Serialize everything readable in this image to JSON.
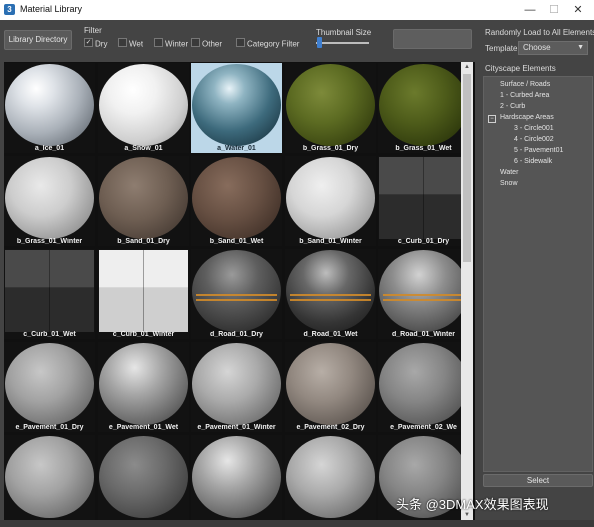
{
  "window": {
    "title": "Material Library",
    "minimize": "—",
    "maximize": "☐",
    "close": "✕"
  },
  "toolbar": {
    "library_directory": "Library Directory",
    "filter_label": "Filter",
    "filters": [
      {
        "label": "Dry",
        "checked": true
      },
      {
        "label": "Wet",
        "checked": false
      },
      {
        "label": "Winter",
        "checked": false
      },
      {
        "label": "Other",
        "checked": false
      }
    ],
    "category_filter": {
      "label": "Category Filter",
      "checked": false
    },
    "thumbnail_size_label": "Thumbnail Size",
    "thumbnail_size_value": 0.02,
    "search_value": ""
  },
  "materials": [
    {
      "label": "a_Ice_01",
      "style": "ice"
    },
    {
      "label": "a_Snow_01",
      "style": "snow"
    },
    {
      "label": "a_Water_01",
      "style": "water",
      "selected": true
    },
    {
      "label": "b_Grass_01_Dry",
      "style": "grass"
    },
    {
      "label": "b_Grass_01_Wet",
      "style": "grasswet"
    },
    {
      "label": "b_Grass_01_Winter",
      "style": "grasswinter"
    },
    {
      "label": "b_Sand_01_Dry",
      "style": "sand"
    },
    {
      "label": "b_Sand_01_Wet",
      "style": "sandwet"
    },
    {
      "label": "b_Sand_01_Winter",
      "style": "sandwinter"
    },
    {
      "label": "c_Curb_01_Dry",
      "style": "curbdry"
    },
    {
      "label": "c_Curb_01_Wet",
      "style": "curbwet"
    },
    {
      "label": "c_Curb_01_Winter",
      "style": "curbwinter"
    },
    {
      "label": "d_Road_01_Dry",
      "style": "road"
    },
    {
      "label": "d_Road_01_Wet",
      "style": "roadwet"
    },
    {
      "label": "d_Road_01_Winter",
      "style": "roadwinter"
    },
    {
      "label": "e_Pavement_01_Dry",
      "style": "pavement"
    },
    {
      "label": "e_Pavement_01_Wet",
      "style": "pavementwet"
    },
    {
      "label": "e_Pavement_01_Winter",
      "style": "pavementwinter"
    },
    {
      "label": "e_Pavement_02_Dry",
      "style": "brick"
    },
    {
      "label": "e_Pavement_02_We",
      "style": "brickwet"
    },
    {
      "label": "",
      "style": "pavement"
    },
    {
      "label": "",
      "style": "cobble"
    },
    {
      "label": "",
      "style": "pavementwet"
    },
    {
      "label": "",
      "style": "pavementwinter"
    },
    {
      "label": "",
      "style": "brickwet"
    }
  ],
  "side": {
    "title": "Randomly Load to All Elements",
    "template_label": "Template",
    "template_value": "Choose",
    "template_arrow": "▼",
    "cityscape_label": "Cityscape Elements",
    "tree": [
      {
        "label": "Surface / Roads",
        "level": 0
      },
      {
        "label": "1 - Curbed Area",
        "level": 1
      },
      {
        "label": "2 - Curb",
        "level": 1
      },
      {
        "label": "Hardscape Areas",
        "level": 0,
        "expanded": true,
        "toggle": "−"
      },
      {
        "label": "3 - Circle001",
        "level": 2
      },
      {
        "label": "4 - Circle002",
        "level": 2
      },
      {
        "label": "5 - Pavement01",
        "level": 2
      },
      {
        "label": "6 - Sidewalk",
        "level": 2
      },
      {
        "label": "Water",
        "level": 0
      },
      {
        "label": "Snow",
        "level": 0
      }
    ],
    "select_label": "Select"
  },
  "watermark": "头条 @3DMAX效果图表现"
}
